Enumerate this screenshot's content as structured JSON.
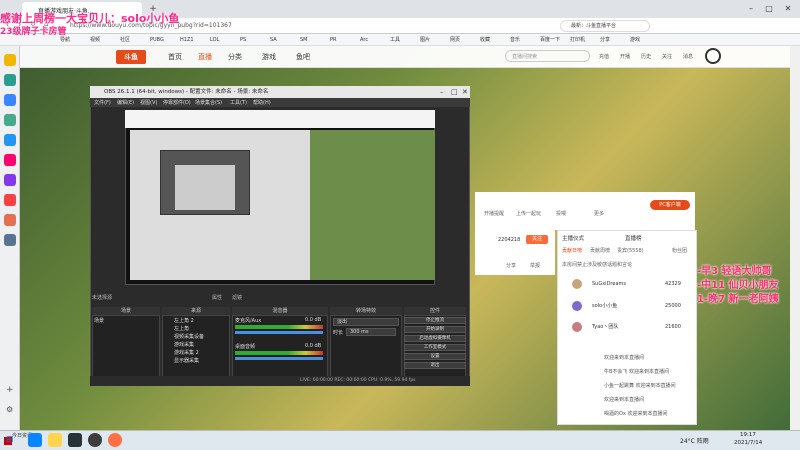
{
  "browser": {
    "tab_title": "直播游戏朋友·斗鱼...",
    "url": "https://www.douyu.com/topic/gyyh_pubg?rid=101367",
    "address_right": "最新：斗鱼直播平台",
    "bookmarks": [
      "导航",
      "视频",
      "社区",
      "PUBG",
      "H1Z1",
      "LOL",
      "PS",
      "SA",
      "SM",
      "PR",
      "Arc",
      "工具",
      "图片",
      "网页",
      "收藏",
      "音乐",
      "百度一下",
      "打印机",
      "分享",
      "游戏"
    ]
  },
  "overlay": {
    "line1": "感谢上周榜一大宝贝儿：solo小小鱼",
    "line2": "23级牌子卡房管",
    "right1": "晚7-早3 轻语大帅哥",
    "right2": "早3-中11 仙贝小朋友",
    "right3": "中11-晚7 新一老阿姨"
  },
  "site": {
    "nav": [
      "首页",
      "直播",
      "分类",
      "游戏",
      "鱼吧"
    ],
    "search_placeholder": "直播间搜索",
    "header_right": [
      "充值",
      "开播",
      "历史",
      "关注",
      "消息",
      "客户端"
    ],
    "actions": [
      "开播提醒",
      "上传一起玩",
      "投喂",
      "更多"
    ],
    "pc_button": "PC客户端",
    "follow_count": "2204218",
    "follow_label": "关注",
    "share": "分享",
    "report": "举报"
  },
  "chat": {
    "tabs": [
      "主播仪式",
      "直播榜"
    ],
    "subtabs": [
      "贡献日榜",
      "贡献周榜",
      "贵宾(5558)",
      "粉丝团"
    ],
    "notice": "本房间禁止涉及敏感话题和言论",
    "ranks": [
      {
        "name": "SuGxiDreams",
        "score": "42329"
      },
      {
        "name": "solo小小鱼",
        "score": "25000"
      },
      {
        "name": "Tyao丶团队",
        "score": "21600"
      }
    ],
    "messages": [
      "欢迎来到本直播间",
      "牛B不会飞 欢迎来到本直播间",
      "小鱼一起跳舞 欢迎来到本直播间",
      "欢迎来到本直播间",
      "喝酒的Ox 欢迎来到本直播间"
    ]
  },
  "obs": {
    "title": "OBS 26.1.1 (64-bit, windows) - 配置文件: 未命名 - 场景: 未命名",
    "menu": [
      "文件(F)",
      "编辑(E)",
      "视图(V)",
      "停靠部件(D)",
      "场景集合(S)",
      "工具(T)",
      "帮助(H)"
    ],
    "source_label": "未选择源",
    "props": "属性",
    "filters": "滤镜",
    "panels": [
      "场景",
      "来源",
      "混音器",
      "转场特效",
      "控件"
    ],
    "scene": "场景",
    "sources": [
      "左上角 2",
      "左上角",
      "视频采集设备",
      "游戏采集",
      "游戏采集 2",
      "显示器采集"
    ],
    "mixer": [
      {
        "name": "麦克风/Aux",
        "db": "0.0 dB"
      },
      {
        "name": "桌面音频",
        "db": "0.0 dB"
      }
    ],
    "transition": "淡出",
    "duration_label": "时长",
    "duration": "300 ms",
    "controls": [
      "停止推流",
      "开始录制",
      "启动虚拟摄像机",
      "工作室模式",
      "设置",
      "退出"
    ],
    "status": "LIVE: 00:00:00   REC: 00:00:00   CPU: 0.9%, 59.94 fps"
  },
  "taskbar": {
    "search": "今日资讯",
    "weather": "24°C 阵雨",
    "time": "19:17",
    "date": "2021/7/14"
  }
}
